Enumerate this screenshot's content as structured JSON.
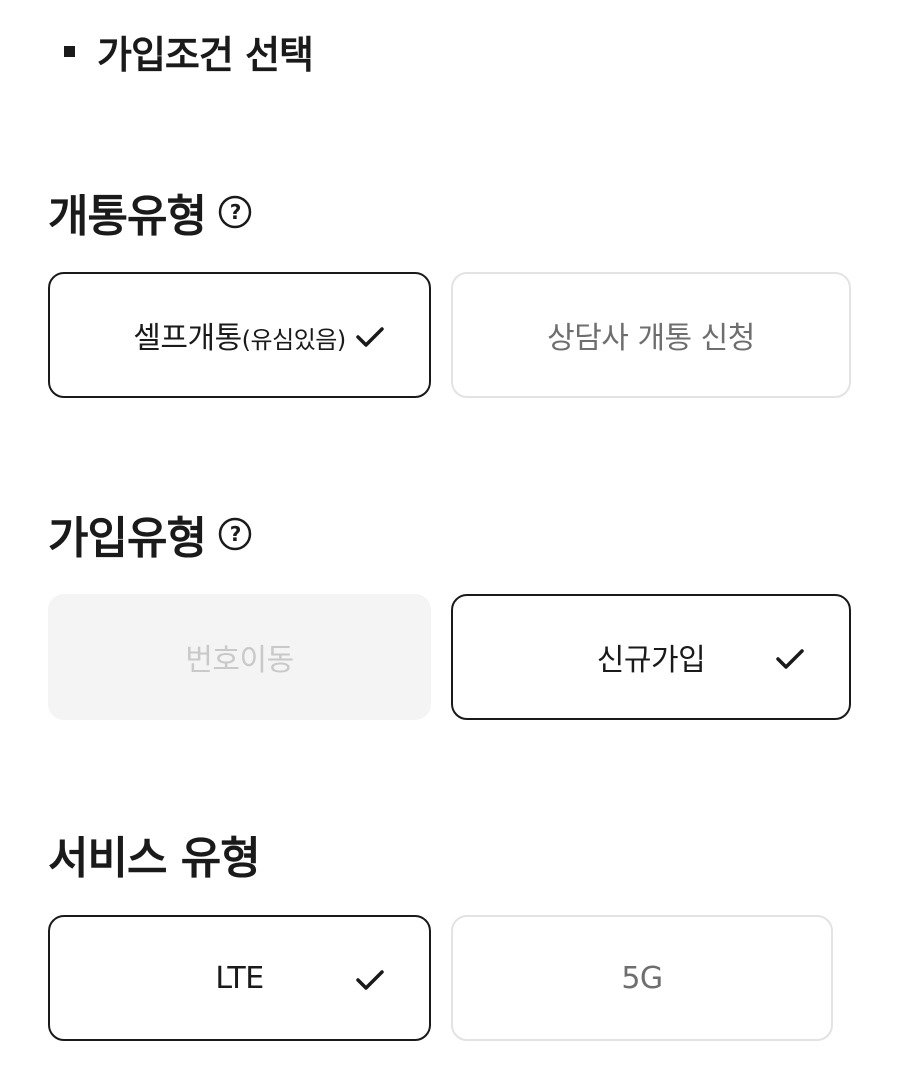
{
  "header": {
    "title": "가입조건 선택"
  },
  "sections": [
    {
      "title": "개통유형",
      "options": [
        {
          "label": "셀프개통",
          "label_suffix": "(유심있음)",
          "state": "selected"
        },
        {
          "label": "상담사 개통 신청",
          "state": "unselected"
        }
      ]
    },
    {
      "title": "가입유형",
      "options": [
        {
          "label": "번호이동",
          "state": "disabled"
        },
        {
          "label": "신규가입",
          "state": "selected"
        }
      ]
    },
    {
      "title": "서비스 유형",
      "options": [
        {
          "label": "LTE",
          "state": "selected"
        },
        {
          "label": "5G",
          "state": "unselected"
        }
      ]
    }
  ],
  "colors": {
    "text": "#1a1a1a",
    "border_selected": "#1a1a1a",
    "border_unselected": "#e3e3e3",
    "disabled_bg": "#f4f4f4"
  },
  "icons": {
    "help": "question-circle-icon",
    "check": "check-icon"
  }
}
